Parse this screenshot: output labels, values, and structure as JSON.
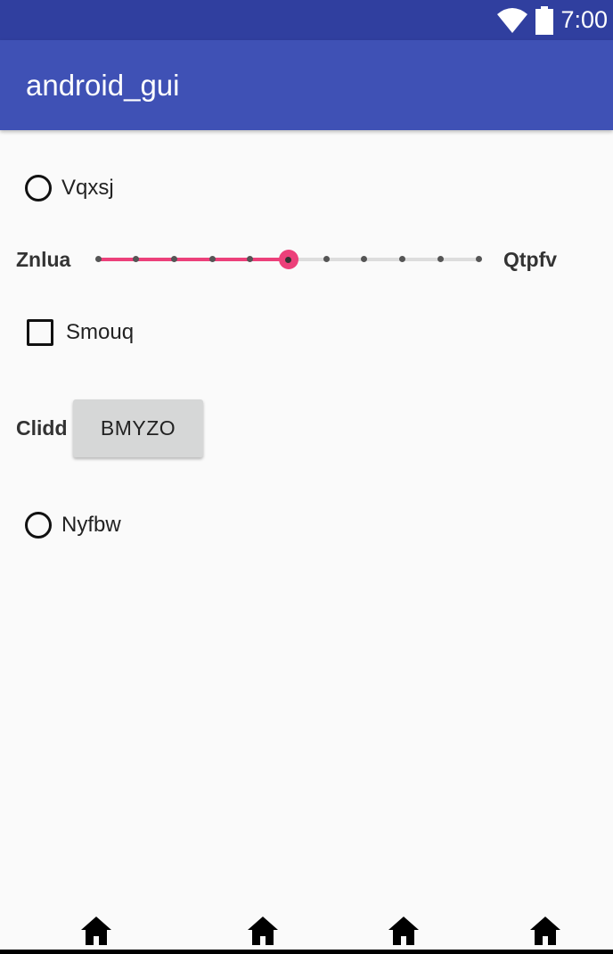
{
  "status_bar": {
    "time": "7:00",
    "icons": [
      "wifi-icon",
      "battery-icon"
    ]
  },
  "app_bar": {
    "title": "android_gui"
  },
  "radio_1": {
    "label": "Vqxsj",
    "checked": false
  },
  "slider": {
    "left_label": "Znlua",
    "right_label": "Qtpfv",
    "steps": 10,
    "value": 5,
    "accent_color": "#ec407a"
  },
  "checkbox": {
    "label": "Smouq",
    "checked": false
  },
  "button_row": {
    "label": "Clidd",
    "button_label": "BMYZO"
  },
  "radio_2": {
    "label": "Nyfbw",
    "checked": false
  },
  "nav_bar": {
    "icons": [
      "home-icon",
      "home-icon",
      "home-icon",
      "home-icon"
    ]
  },
  "colors": {
    "status_bar": "#303f9f",
    "app_bar": "#3f51b5",
    "background": "#fafafa",
    "button": "#d6d7d7"
  }
}
